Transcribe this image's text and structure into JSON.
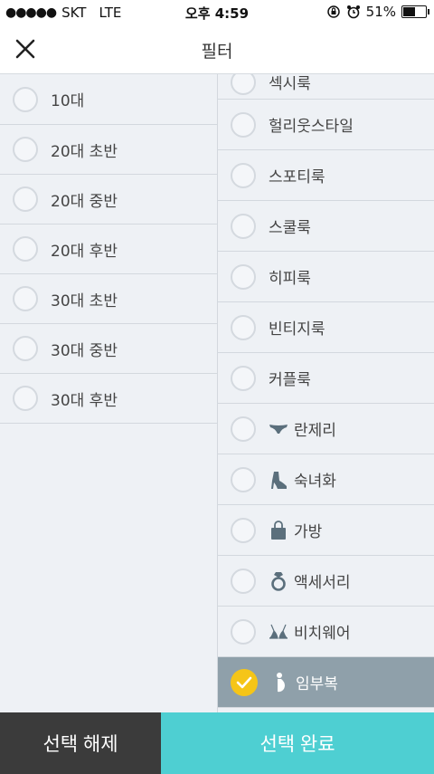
{
  "status_bar": {
    "carrier": "SKT",
    "network": "LTE",
    "time": "오후 4:59",
    "battery": "51%",
    "battery_level": 0.51
  },
  "header": {
    "title": "필터",
    "close_icon": "close-icon"
  },
  "age_options": [
    {
      "label": "10대"
    },
    {
      "label": "20대 초반"
    },
    {
      "label": "20대 중반"
    },
    {
      "label": "20대 후반"
    },
    {
      "label": "30대 초반"
    },
    {
      "label": "30대 중반"
    },
    {
      "label": "30대 후반"
    }
  ],
  "style_options": [
    {
      "label": "섹시룩",
      "icon": null,
      "selected": false
    },
    {
      "label": "헐리웃스타일",
      "icon": null,
      "selected": false
    },
    {
      "label": "스포티룩",
      "icon": null,
      "selected": false
    },
    {
      "label": "스쿨룩",
      "icon": null,
      "selected": false
    },
    {
      "label": "히피룩",
      "icon": null,
      "selected": false
    },
    {
      "label": "빈티지룩",
      "icon": null,
      "selected": false
    },
    {
      "label": "커플룩",
      "icon": null,
      "selected": false
    },
    {
      "label": "란제리",
      "icon": "lingerie-icon",
      "selected": false
    },
    {
      "label": "숙녀화",
      "icon": "high-heel-icon",
      "selected": false
    },
    {
      "label": "가방",
      "icon": "handbag-icon",
      "selected": false
    },
    {
      "label": "액세서리",
      "icon": "ring-icon",
      "selected": false
    },
    {
      "label": "비치웨어",
      "icon": "bikini-icon",
      "selected": false
    },
    {
      "label": "임부복",
      "icon": "maternity-icon",
      "selected": true
    }
  ],
  "buttons": {
    "clear": "선택 해제",
    "done": "선택 완료"
  },
  "colors": {
    "selected_row": "#8fa0aa",
    "check": "#f5c518",
    "done_button": "#4ecfd2",
    "clear_button": "#3b3b3b"
  }
}
